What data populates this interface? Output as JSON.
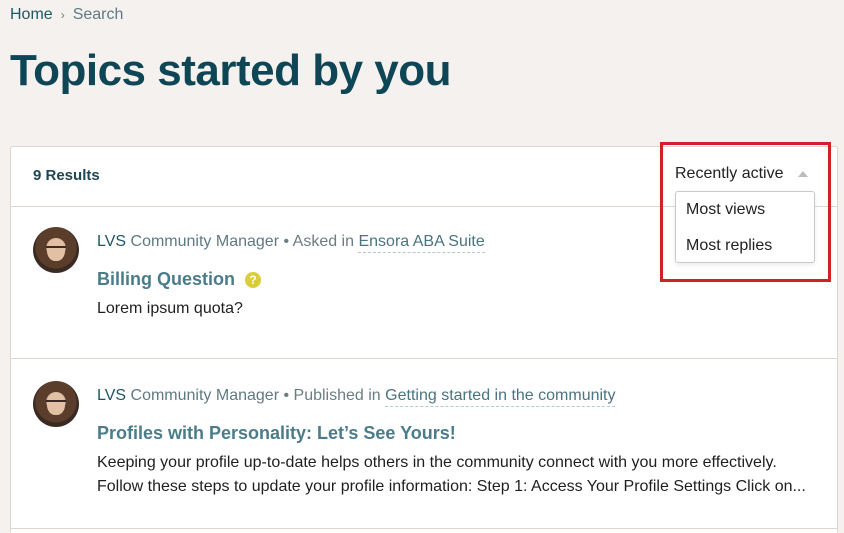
{
  "breadcrumb": {
    "home": "Home",
    "separator": "›",
    "current": "Search"
  },
  "page_title": "Topics started by you",
  "results": {
    "count_label": "9 Results"
  },
  "sort": {
    "selected": "Recently active",
    "options": [
      "Most views",
      "Most replies"
    ]
  },
  "topics": [
    {
      "author": "LVS",
      "role": "Community Manager",
      "action": "Asked in",
      "place": "Ensora ABA Suite",
      "title": "Billing Question",
      "icon": "question-icon",
      "icon_glyph": "?",
      "excerpt_line1": "Lorem ipsum quota?",
      "excerpt_line2": ""
    },
    {
      "author": "LVS",
      "role": "Community Manager",
      "action": "Published in",
      "place": "Getting started in the community",
      "title": "Profiles with Personality: Let’s See Yours!",
      "excerpt_line1": "Keeping your profile up-to-date helps others in the community connect with you more effectively.",
      "excerpt_line2": "Follow these steps to update your profile information: Step 1: Access Your Profile Settings Click on..."
    }
  ],
  "meta_separator": "•",
  "colors": {
    "title": "#0f4656",
    "link": "#4a7c8a",
    "highlight": "#d1202a",
    "question_badge": "#d9cd3a"
  }
}
